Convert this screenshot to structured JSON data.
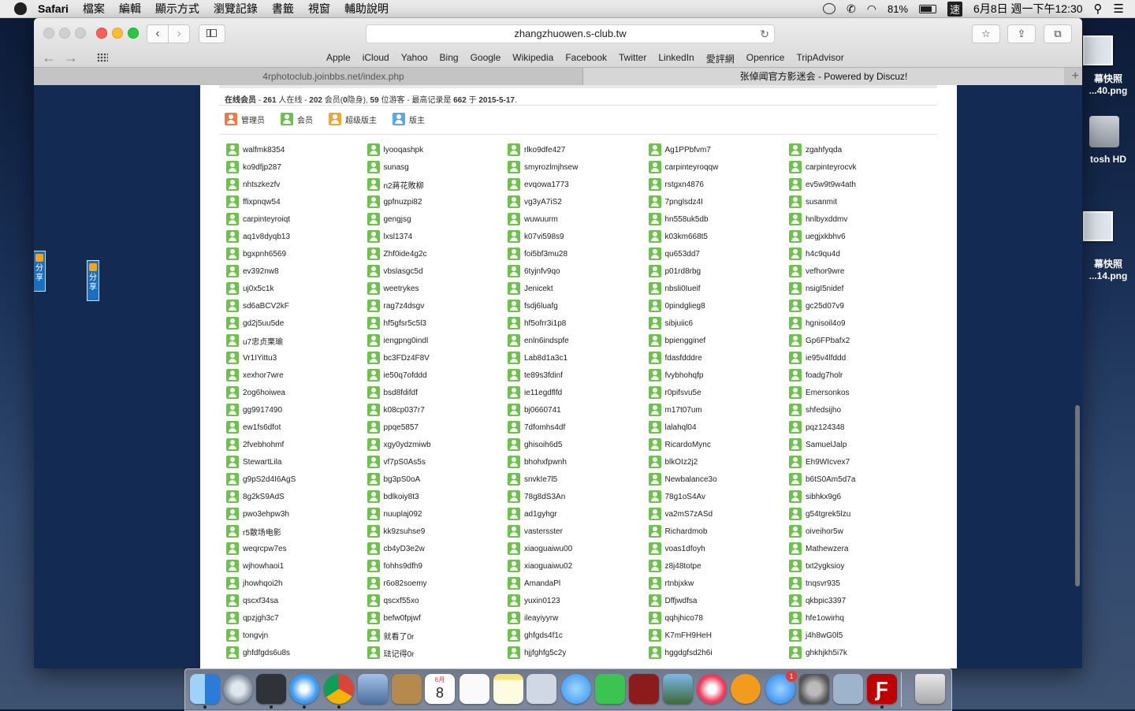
{
  "menubar": {
    "app": "Safari",
    "items": [
      "檔案",
      "編輯",
      "顯示方式",
      "瀏覽記錄",
      "書籤",
      "視窗",
      "輔助說明"
    ],
    "battery": "81%",
    "ime": "速",
    "datetime": "6月8日 週一下午12:30"
  },
  "desktop": {
    "thumb1_label": "幕快照",
    "thumb1_file": "...40.png",
    "hdd_label": "tosh HD",
    "thumb2_label": "幕快照",
    "thumb2_file": "...14.png"
  },
  "browser": {
    "url": "zhangzhuowen.s-club.tw",
    "favorites": [
      "Apple",
      "iCloud",
      "Yahoo",
      "Bing",
      "Google",
      "Wikipedia",
      "Facebook",
      "Twitter",
      "LinkedIn",
      "愛評網",
      "Openrice",
      "TripAdvisor"
    ],
    "tabs": [
      "4rphotoclub.joinbbs.net/index.php",
      "张倬闻官方影迷会 - Powered by Discuz!"
    ]
  },
  "page": {
    "online": {
      "label": "在线会员",
      "total": "261",
      "total_label": "人在线",
      "members": "202",
      "members_label": "会员(",
      "hidden": "0",
      "hidden_label": "隐身),",
      "guests": "59",
      "guests_label": "位游客",
      "record_label": "- 最高记录是",
      "record": "662",
      "record_on": "于",
      "record_date": "2015-5-17",
      "sep": "-"
    },
    "legend": [
      {
        "label": "管理员",
        "color": "o"
      },
      {
        "label": "会员",
        "color": "g"
      },
      {
        "label": "超级版主",
        "color": "y"
      },
      {
        "label": "版主",
        "color": "b"
      }
    ],
    "share_label": "分享",
    "users": [
      "walfmk8354",
      "lyooqashpk",
      "rlko9dfe427",
      "Ag1PPbfvm7",
      "zgahfyqda",
      "ko9dfjp287",
      "sunasg",
      "smyrozlmjhsew",
      "carpinteyroqqw",
      "carpinteyrocvk",
      "nhtszkezfv",
      "n2蔣花敗柳",
      "evqowa1773",
      "rstgxn4876",
      "ev5w9t9w4ath",
      "ffixpnqw54",
      "gpfnuzpi82",
      "vg3yA7iS2",
      "7pnglsdz4I",
      "susanmit",
      "carpinteyroiqt",
      "gengjsg",
      "wuwuurm",
      "hn558uk5db",
      "hnlbyxddmv",
      "aq1v8dyqb13",
      "lxsl1374",
      "k07vi598s9",
      "k03km668t5",
      "uegjxkbhv6",
      "bgxpnh6569",
      "Zhf0ide4g2c",
      "foi5bf3mu28",
      "qu653dd7",
      "h4c9qu4d",
      "ev392nw8",
      "vbslasgc5d",
      "6tyjnfv9qo",
      "p01rd8rbg",
      "vefhor9wre",
      "uj0x5c1k",
      "weetrykes",
      "Jenicekt",
      "nbsli0Iueif",
      "nsigI5nidef",
      "sd6aBCV2kF",
      "rag7z4dsgv",
      "fsdj6luafg",
      "0pindglieg8",
      "gc25d07v9",
      "gd2j5uu5de",
      "hf5gfsr5c5l3",
      "hf5ofrr3i1p8",
      "sibjuiic6",
      "hgnisoil4o9",
      "u7忠贞栗瑜",
      "iengpng0indl",
      "enln6indspfe",
      "bpiengginef",
      "Gp6FPbafx2",
      "Vr1IYittu3",
      "bc3FDz4F8V",
      "Lab8d1a3c1",
      "fdasfdddre",
      "ie95v4lfddd",
      "xexhor7wre",
      "ie50q7ofddd",
      "te89s3fdinf",
      "fvybhohqfp",
      "foadg7holr",
      "2og6hoiwea",
      "bsd8fdifdf",
      "ie11egdflfd",
      "r0pifsvu5e",
      "Emersonkos",
      "gg9917490",
      "k08cp037r7",
      "bj0660741",
      "m17t07um",
      "shfedsijho",
      "ew1fs6dfot",
      "ppqe5857",
      "7dfomhs4df",
      "lalahql04",
      "pqz124348",
      "2fvebhohmf",
      "xgy0ydzmiwb",
      "ghisoih6d5",
      "RicardoMync",
      "SamuelJalp",
      "StewartLila",
      "vf7pS0As5s",
      "bhohxfpwnh",
      "blkOIz2j2",
      "Eh9WIcvex7",
      "g9pS2d4I6AgS",
      "bg3pS0oA",
      "snvkIe7l5",
      "Newbalance3o",
      "b6tS0Am5d7a",
      "8g2kS9AdS",
      "bdlkoiy8t3",
      "78g8dS3An",
      "78g1oS4Av",
      "sibhkx9g6",
      "pwo3ehpw3h",
      "nuuplaj092",
      "ad1gyhgr",
      "va2mS7zASd",
      "g54tgrek5lzu",
      "r5散场电影",
      "kk9zsuhse9",
      "vastersster",
      "Richardmob",
      "oiveihor5w",
      "weqrcpw7es",
      "cb4yD3e2w",
      "xiaoguaiwu00",
      "voas1dfoyh",
      "Mathewzera",
      "wjhowhaoi1",
      "fohhs9dfh9",
      "xiaoguaiwu02",
      "z8j48totpe",
      "txt2ygksioy",
      "jhowhqoi2h",
      "r6o82soemy",
      "AmandaPl",
      "rtnbjxkw",
      "tnqsvr935",
      "qscxf34sa",
      "qscxf55xo",
      "yuxin0123",
      "Dffjwdfsa",
      "qkbpic3397",
      "qpzjgh3c7",
      "befw0fpjwf",
      "ileayiyyrw",
      "qqhjhico78",
      "hfe1owirhq",
      "tongvjn",
      "就看了0r",
      "ghfgds4f1c",
      "K7mFH9HeH",
      "j4h8wG0l5",
      "ghfdfgds6u8s",
      "琺记得0r",
      "hjjfghfg5c2y",
      "hggdgfsd2h6i",
      "ghkhjkh5i7k"
    ]
  },
  "dock": {
    "calendar_month": "6月",
    "calendar_day": "8",
    "appstore_badge": "1"
  }
}
